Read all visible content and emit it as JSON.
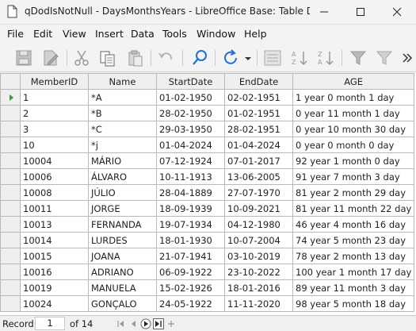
{
  "window": {
    "title": "qDodIsNotNull - DaysMonthsYears - LibreOffice Base: Table Data..."
  },
  "menu": [
    "File",
    "Edit",
    "View",
    "Insert",
    "Data",
    "Tools",
    "Window",
    "Help"
  ],
  "table": {
    "columns": [
      "MemberID",
      "Name",
      "StartDate",
      "EndDate",
      "AGE"
    ],
    "rows": [
      [
        "1",
        "*A",
        "01-02-1950",
        "02-02-1951",
        "1 year 0 month 1 day"
      ],
      [
        "2",
        "*B",
        "28-02-1950",
        "01-02-1951",
        "0 year 11 month 1 day"
      ],
      [
        "3",
        "*C",
        "29-03-1950",
        "28-02-1951",
        "0 year 10 month 30 day"
      ],
      [
        "10",
        "*j",
        "01-04-2024",
        "01-04-2024",
        "0 year 0 month 0 day"
      ],
      [
        "10004",
        "MÁRIO",
        "07-12-1924",
        "07-01-2017",
        "92 year 1 month 0 day"
      ],
      [
        "10006",
        "ÁLVARO",
        "10-11-1913",
        "13-06-2005",
        "91 year 7 month 3 day"
      ],
      [
        "10008",
        "JÚLIO",
        "28-04-1889",
        "27-07-1970",
        "81 year 2 month 29 day"
      ],
      [
        "10011",
        "JORGE",
        "18-09-1939",
        "10-09-2021",
        "81 year 11 month 22 day"
      ],
      [
        "10013",
        "FERNANDA",
        "19-07-1934",
        "04-12-1980",
        "46 year 4 month 16 day"
      ],
      [
        "10014",
        "LURDES",
        "18-01-1930",
        "10-07-2004",
        "74 year 5 month 23 day"
      ],
      [
        "10015",
        "JOANA",
        "21-07-1941",
        "03-10-2019",
        "78 year 2 month 13 day"
      ],
      [
        "10016",
        "ADRIANO",
        "06-09-1922",
        "23-10-2022",
        "100 year 1 month 17 day"
      ],
      [
        "10019",
        "MANUELA",
        "15-02-1926",
        "18-01-2016",
        "89 year 11 month 3 day"
      ],
      [
        "10024",
        "GONÇALO",
        "24-05-1922",
        "11-11-2020",
        "98 year 5 month 18 day"
      ]
    ]
  },
  "navigation": {
    "record_label": "Record",
    "current_record": "1",
    "total_text": "of 14"
  },
  "colors": {
    "accent": "#1e6fd9",
    "current_row_marker": "#2e9c37"
  },
  "icons": [
    "document-icon",
    "minimize-icon",
    "maximize-icon",
    "close-icon",
    "save-icon",
    "edit-icon",
    "cut-icon",
    "copy-icon",
    "paste-icon",
    "undo-icon",
    "find-icon",
    "refresh-icon",
    "sort-icon",
    "sort-ascending-icon",
    "sort-descending-icon",
    "autofilter-icon",
    "remove-filter-icon",
    "more-icon"
  ]
}
